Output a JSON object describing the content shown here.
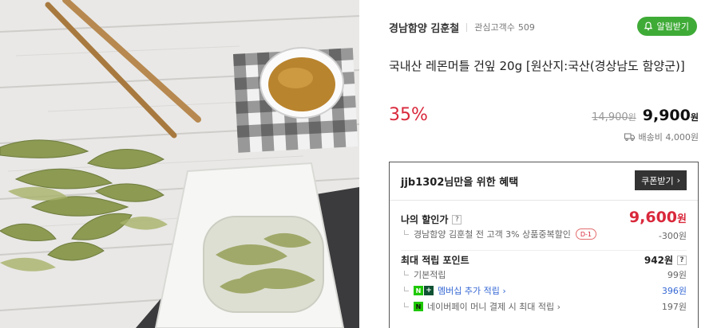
{
  "store": {
    "name": "경남함양 김훈철",
    "favorite_label": "관심고객수",
    "favorite_count": "509",
    "alarm_label": "알림받기"
  },
  "product": {
    "title": "국내산 레몬머틀 건잎 20g [원산지:국산(경상남도 함양군)]",
    "discount": "35%",
    "original_price": "14,900",
    "original_unit": "원",
    "sale_price": "9,900",
    "sale_unit": "원",
    "shipping": "배송비 4,000원"
  },
  "benefit": {
    "heading": "jjb1302님만을 위한 혜택",
    "coupon_button": "쿠폰받기",
    "my_price_label": "나의 할인가",
    "my_price": "9,600",
    "my_price_unit": "원",
    "store_discount_text": "경남함양 김훈철 전 고객 3% 상품중복할인",
    "store_discount_badge": "D-1",
    "store_discount_value": "-300원",
    "points_label": "최대 적립 포인트",
    "points_value": "942원",
    "basic_label": "기본적립",
    "basic_value": "99원",
    "membership_label": "멤버십 추가 적립",
    "membership_value": "396원",
    "naverpay_label": "네이버페이 머니 결제 시 최대 적립",
    "naverpay_value": "197원"
  },
  "icons": {
    "alarm": "bell-icon",
    "shipping": "truck-icon",
    "help": "question-icon",
    "naver_plus": "naver-plus-icon",
    "naver_pay": "naver-pay-icon"
  },
  "colors": {
    "accent_green": "#3fab37",
    "discount_red": "#d9283b",
    "link_blue": "#3668d4"
  }
}
